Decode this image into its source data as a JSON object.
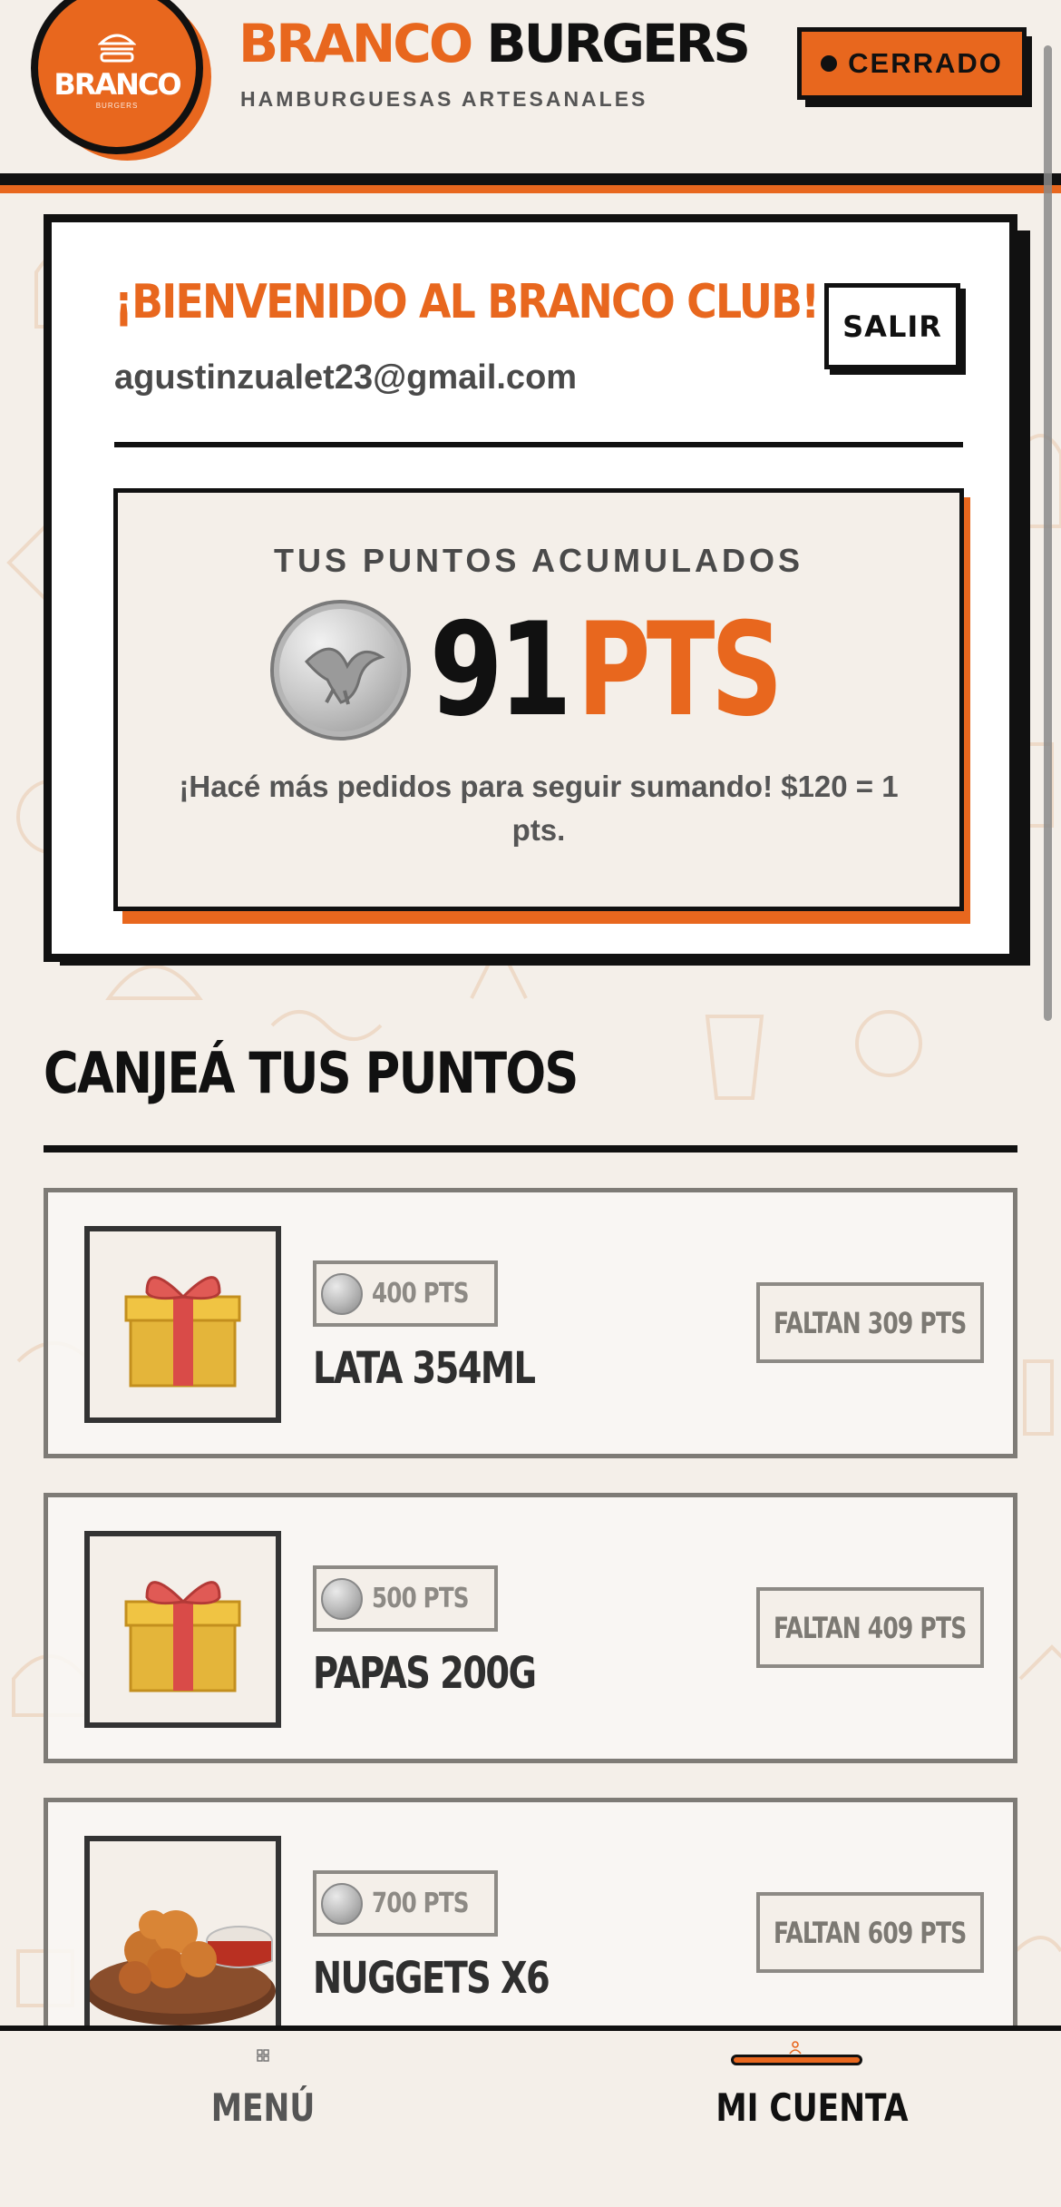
{
  "header": {
    "logo_text": "BRANCO",
    "logo_subtext": "BURGERS",
    "brand_first": "BRANCO",
    "brand_second": "BURGERS",
    "tagline": "HAMBURGUESAS ARTESANALES",
    "status_label": "CERRADO"
  },
  "club": {
    "welcome": "¡BIENVENIDO AL BRANCO CLUB!",
    "email": "agustinzualet23@gmail.com",
    "logout_label": "SALIR",
    "points_title": "TUS PUNTOS ACUMULADOS",
    "points_value": "91",
    "points_unit": "PTS",
    "points_note": "¡Hacé más pedidos para seguir sumando! $120 = 1 pts."
  },
  "redeem": {
    "title": "CANJEÁ TUS PUNTOS",
    "rewards": [
      {
        "cost": "400 PTS",
        "name": "LATA 354ML",
        "missing": "FALTAN 309 PTS",
        "image": "gift-icon"
      },
      {
        "cost": "500 PTS",
        "name": "PAPAS 200G",
        "missing": "FALTAN 409 PTS",
        "image": "gift-icon"
      },
      {
        "cost": "700 PTS",
        "name": "NUGGETS X6",
        "missing": "FALTAN 609 PTS",
        "image": "nuggets-image"
      }
    ]
  },
  "nav": {
    "menu_label": "MENÚ",
    "account_label": "MI CUENTA"
  },
  "colors": {
    "accent": "#e8671e",
    "ink": "#111111",
    "background": "#f4efe9"
  }
}
